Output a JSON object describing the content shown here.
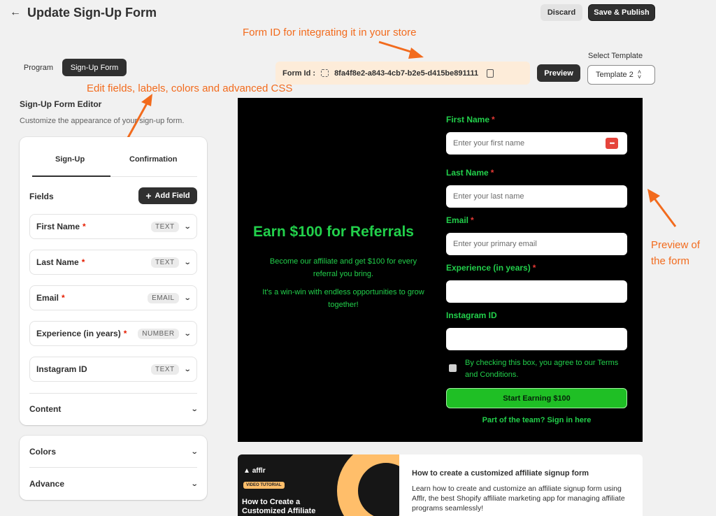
{
  "header": {
    "back_icon": "arrow-left-icon",
    "title": "Update Sign-Up Form",
    "discard_label": "Discard",
    "publish_label": "Save & Publish"
  },
  "annotations": {
    "form_id": "Form ID for integrating it in your store",
    "edit": "Edit fields, labels, colors and advanced CSS",
    "preview_line1": "Preview of",
    "preview_line2": "the form",
    "color": "#f26b1d"
  },
  "top_tabs": {
    "program": "Program",
    "signup_form": "Sign-Up Form"
  },
  "form_id": {
    "label": "Form Id :",
    "value": "8fa4f8e2-a843-4cb7-b2e5-d415be891111"
  },
  "preview_button": "Preview",
  "template_select": {
    "label": "Select Template",
    "value": "Template 2"
  },
  "editor": {
    "title": "Sign-Up Form Editor",
    "subtitle": "Customize the appearance of your sign-up form.",
    "tabs": [
      "Sign-Up",
      "Confirmation"
    ],
    "fields_label": "Fields",
    "add_field_label": "Add Field",
    "fields": [
      {
        "name": "First Name",
        "required": "*",
        "type": "TEXT"
      },
      {
        "name": "Last Name",
        "required": "*",
        "type": "TEXT"
      },
      {
        "name": "Email",
        "required": "*",
        "type": "EMAIL"
      },
      {
        "name": "Experience (in years)",
        "required": "*",
        "type": "NUMBER"
      },
      {
        "name": "Instagram ID",
        "required": "",
        "type": "TEXT"
      }
    ],
    "content_label": "Content",
    "colors_label": "Colors",
    "advance_label": "Advance"
  },
  "preview": {
    "headline": "Earn $100 for Referrals",
    "text1": "Become our affiliate and get $100 for every referral you bring.",
    "text2": "It's a win-win with endless opportunities to grow together!",
    "fields": [
      {
        "label": "First Name",
        "required": "*",
        "placeholder": "Enter your first name"
      },
      {
        "label": "Last Name",
        "required": "*",
        "placeholder": "Enter your last name"
      },
      {
        "label": "Email",
        "required": "*",
        "placeholder": "Enter your primary email"
      },
      {
        "label": "Experience (in years)",
        "required": "*",
        "placeholder": ""
      },
      {
        "label": "Instagram ID",
        "required": "",
        "placeholder": ""
      }
    ],
    "terms": "By checking this box, you agree to our Terms and Conditions.",
    "cta": "Start Earning $100",
    "signin": "Part of the team? Sign in here",
    "accent_color": "#22d04b"
  },
  "tutorial": {
    "logo": "afflr",
    "badge": "VIDEO TUTORIAL",
    "thumb_title": "How to Create a Customized Affiliate",
    "title": "How to create a customized affiliate signup form",
    "description": "Learn how to create and customize an affiliate signup form using Afflr, the best Shopify affiliate marketing app for managing affiliate programs seamlessly!"
  }
}
